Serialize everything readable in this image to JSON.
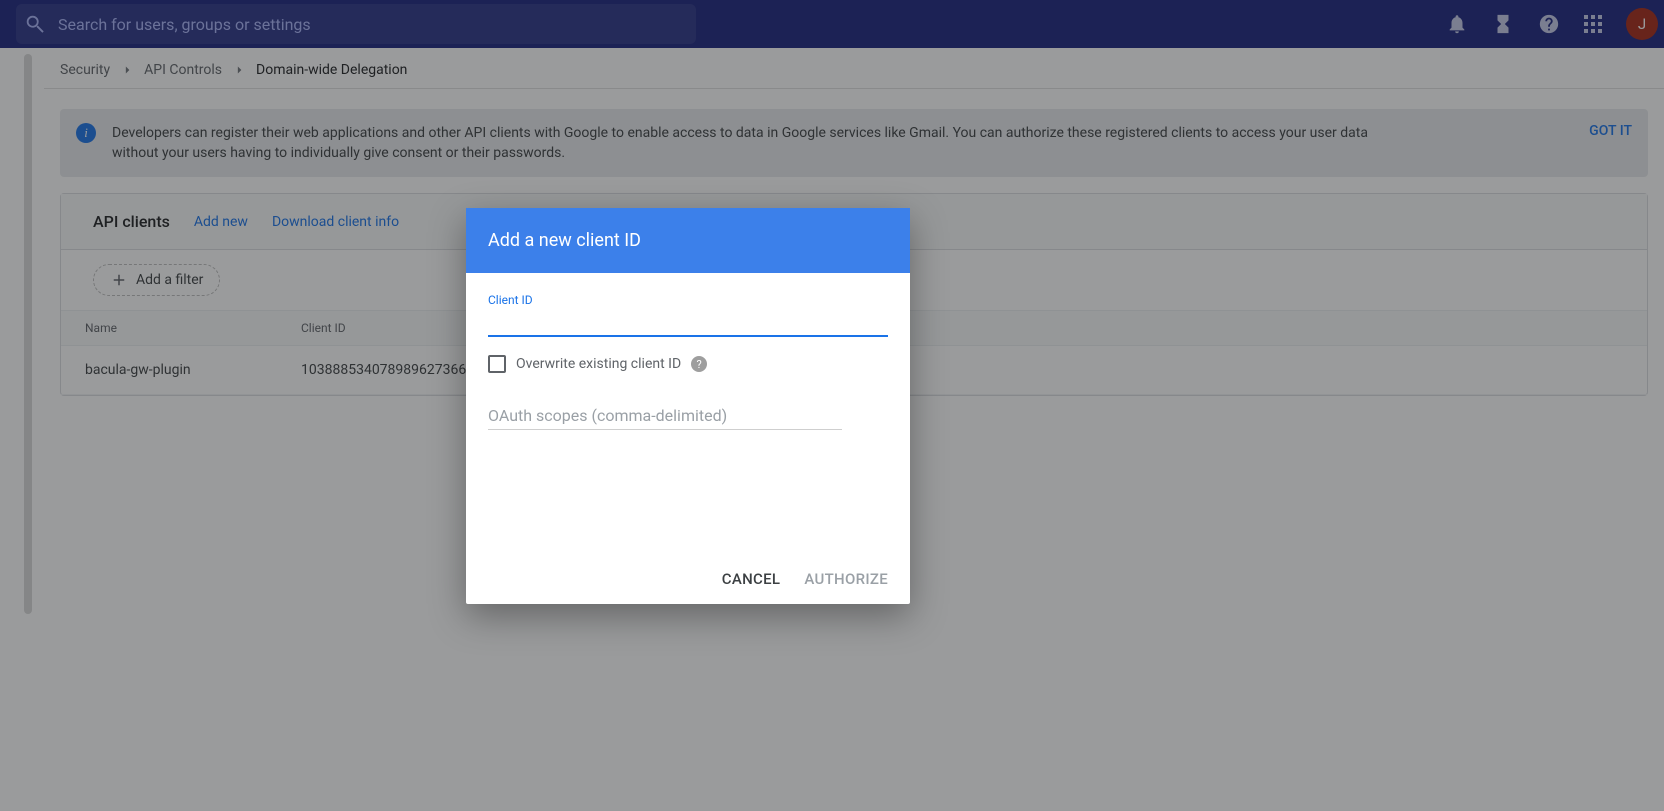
{
  "topbar": {
    "search_placeholder": "Search for users, groups or settings",
    "avatar_initial": "J"
  },
  "breadcrumb": {
    "items": [
      "Security",
      "API Controls",
      "Domain-wide Delegation"
    ]
  },
  "banner": {
    "text": "Developers can register their web applications and other API clients with Google to enable access to data in Google services like Gmail. You can authorize these registered clients to access your user data without your users having to individually give consent or their passwords.",
    "action": "GOT IT"
  },
  "card": {
    "title": "API clients",
    "link_add": "Add new",
    "link_download": "Download client info",
    "filter_label": "Add a filter",
    "columns": {
      "name": "Name",
      "client_id": "Client ID"
    },
    "rows": [
      {
        "name": "bacula-gw-plugin",
        "client_id": "103888534078989627366"
      }
    ]
  },
  "dialog": {
    "title": "Add a new client ID",
    "client_id_label": "Client ID",
    "client_id_value": "",
    "overwrite_label": "Overwrite existing client ID",
    "scopes_placeholder": "OAuth scopes (comma-delimited)",
    "scopes_value": "",
    "cancel": "CANCEL",
    "authorize": "AUTHORIZE"
  }
}
